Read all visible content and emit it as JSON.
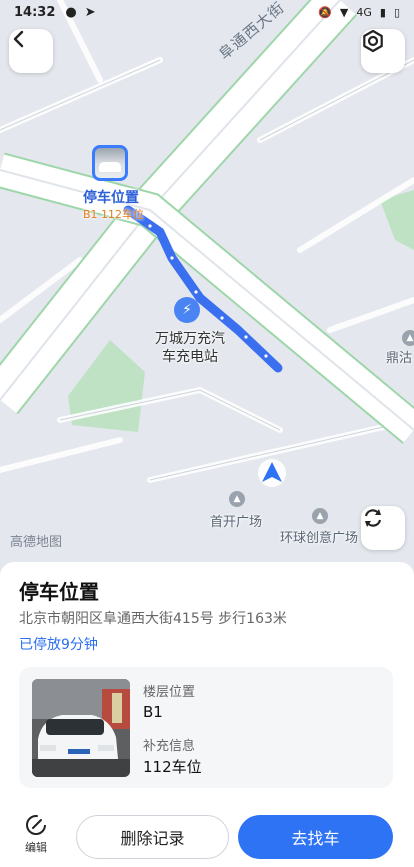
{
  "status_bar": {
    "time": "14:32",
    "network": "4G",
    "icons": [
      "wechat-icon",
      "send-icon",
      "mute-icon",
      "wifi-icon",
      "signal-icon",
      "battery-icon"
    ]
  },
  "map": {
    "road_name": "阜通西大街",
    "parking_marker": {
      "title": "停车位置",
      "sub": "B1 112车位"
    },
    "charging_station": {
      "label": "万城万充汽车充电站"
    },
    "pois": [
      {
        "name": "首开广场"
      },
      {
        "name": "环球创意广场"
      },
      {
        "name": "鼎沽"
      }
    ],
    "brand": "高德地图",
    "colors": {
      "route": "#3a6ff0",
      "road": "#ffffff",
      "road_edge": "#9ed6a9",
      "green_area": "#bfe2c4",
      "background": "#e4e8ee"
    }
  },
  "sheet": {
    "title": "停车位置",
    "address": "北京市朝阳区阜通西大街415号  步行163米",
    "duration": "已停放9分钟",
    "floor_label": "楼层位置",
    "floor_value": "B1",
    "extra_label": "补充信息",
    "extra_value": "112车位"
  },
  "actions": {
    "edit_label": "编辑",
    "delete_label": "删除记录",
    "go_label": "去找车"
  }
}
